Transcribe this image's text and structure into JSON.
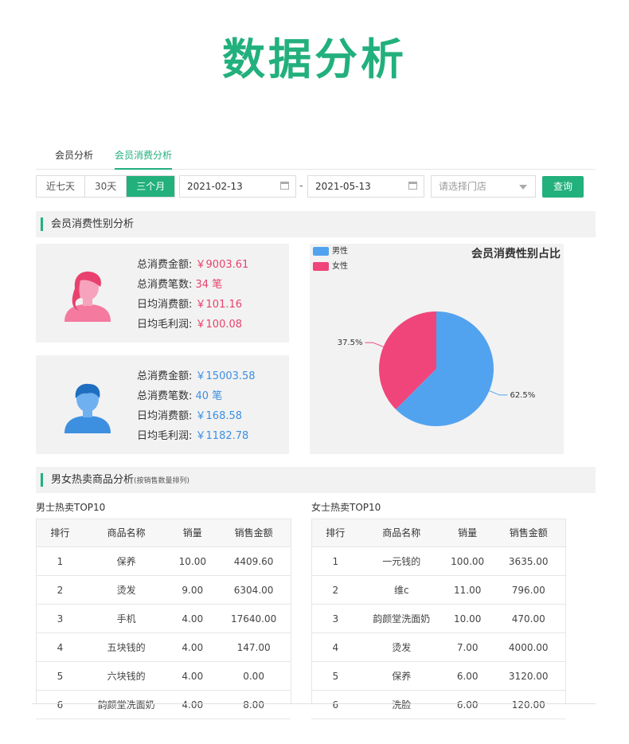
{
  "hero_title": "数据分析",
  "tabs": [
    {
      "label": "会员分析",
      "active": false
    },
    {
      "label": "会员消费分析",
      "active": true
    }
  ],
  "filters": {
    "ranges": [
      {
        "label": "近七天",
        "active": false
      },
      {
        "label": "30天",
        "active": false
      },
      {
        "label": "三个月",
        "active": true
      }
    ],
    "date_from": "2021-02-13",
    "date_sep": "-",
    "date_to": "2021-05-13",
    "store_placeholder": "请选择门店",
    "query_label": "查询"
  },
  "section1_title": "会员消费性别分析",
  "female_stats": [
    {
      "key": "总消费金额:",
      "value": "￥9003.61"
    },
    {
      "key": "总消费笔数:",
      "value": "34 笔"
    },
    {
      "key": "日均消费额:",
      "value": "￥101.16"
    },
    {
      "key": "日均毛利润:",
      "value": "￥100.08"
    }
  ],
  "male_stats": [
    {
      "key": "总消费金额:",
      "value": "￥15003.58"
    },
    {
      "key": "总消费笔数:",
      "value": "40 笔"
    },
    {
      "key": "日均消费额:",
      "value": "￥168.58"
    },
    {
      "key": "日均毛利润:",
      "value": "￥1182.78"
    }
  ],
  "chart_data": {
    "type": "pie",
    "title": "会员消费性别占比",
    "legend_position": "top-left",
    "slices": [
      {
        "name": "男性",
        "value": 62.5,
        "label": "62.5%",
        "color": "#52a3ef"
      },
      {
        "name": "女性",
        "value": 37.5,
        "label": "37.5%",
        "color": "#f0457a"
      }
    ]
  },
  "section2_title": "男女热卖商品分析",
  "section2_note": "(按销售数量排列)",
  "headers": [
    "排行",
    "商品名称",
    "销量",
    "销售金额"
  ],
  "male_table_title": "男士热卖TOP10",
  "male_rows": [
    [
      "1",
      "保养",
      "10.00",
      "4409.60"
    ],
    [
      "2",
      "烫发",
      "9.00",
      "6304.00"
    ],
    [
      "3",
      "手机",
      "4.00",
      "17640.00"
    ],
    [
      "4",
      "五块钱的",
      "4.00",
      "147.00"
    ],
    [
      "5",
      "六块钱的",
      "4.00",
      "0.00"
    ],
    [
      "6",
      "韵颜堂洗面奶",
      "4.00",
      "8.00"
    ]
  ],
  "female_table_title": "女士热卖TOP10",
  "female_rows": [
    [
      "1",
      "一元钱的",
      "100.00",
      "3635.00"
    ],
    [
      "2",
      "维c",
      "11.00",
      "796.00"
    ],
    [
      "3",
      "韵颜堂洗面奶",
      "10.00",
      "470.00"
    ],
    [
      "4",
      "烫发",
      "7.00",
      "4000.00"
    ],
    [
      "5",
      "保养",
      "6.00",
      "3120.00"
    ],
    [
      "6",
      "洗脸",
      "6.00",
      "120.00"
    ]
  ]
}
